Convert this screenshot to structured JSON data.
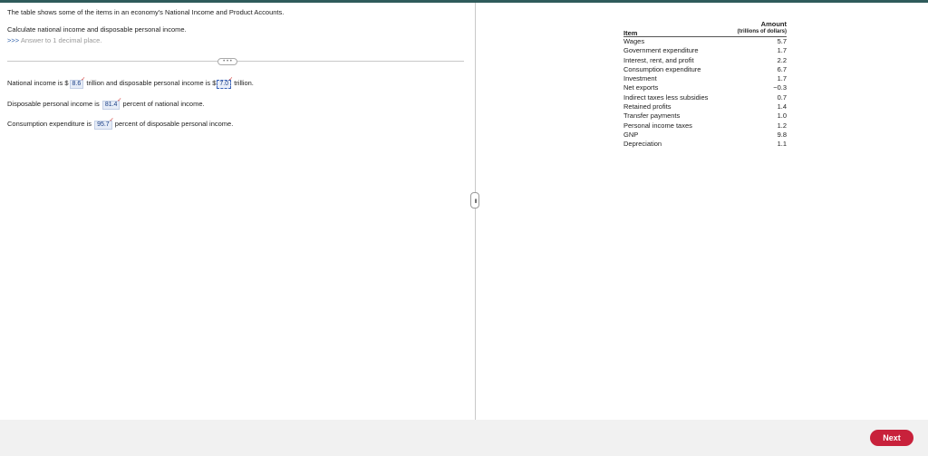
{
  "question": {
    "intro": "The table shows some of the items in an economy's National Income and Product Accounts.",
    "task": "Calculate national income and disposable personal income.",
    "hint_arrows": ">>>",
    "hint_text": "Answer to 1 decimal place.",
    "more_label": "• • •",
    "line1": {
      "pre": "National income is $",
      "ni": "8.6",
      "mid": "trillion and disposable personal income is $",
      "dpi": "7.0",
      "post": "trillion."
    },
    "line2": {
      "pre": "Disposable personal income is",
      "val": "81.4",
      "post": "percent of national income."
    },
    "line3": {
      "pre": "Consumption expenditure is",
      "val": "95.7",
      "post": "percent of disposable personal income."
    }
  },
  "table": {
    "header_item": "Item",
    "header_amount": "Amount",
    "header_amount_sub": "(trillions of dollars)",
    "rows": [
      {
        "item": "Wages",
        "amount": "5.7"
      },
      {
        "item": "Government expenditure",
        "amount": "1.7"
      },
      {
        "item": "Interest, rent, and profit",
        "amount": "2.2"
      },
      {
        "item": "Consumption expenditure",
        "amount": "6.7"
      },
      {
        "item": "Investment",
        "amount": "1.7"
      },
      {
        "item": "Net exports",
        "amount": "−0.3"
      },
      {
        "item": "Indirect taxes less subsidies",
        "amount": "0.7"
      },
      {
        "item": "Retained profits",
        "amount": "1.4"
      },
      {
        "item": "Transfer payments",
        "amount": "1.0"
      },
      {
        "item": "Personal income taxes",
        "amount": "1.2"
      },
      {
        "item": "GNP",
        "amount": "9.8"
      },
      {
        "item": "Depreciation",
        "amount": "1.1"
      }
    ]
  },
  "footer": {
    "next_label": "Next"
  },
  "colors": {
    "accent": "#c8213b",
    "link": "#2b5da8",
    "answer_bg": "#e6ecf7"
  },
  "icons": {
    "correct_mark": "✓",
    "splitter": "drag-handle-icon"
  }
}
